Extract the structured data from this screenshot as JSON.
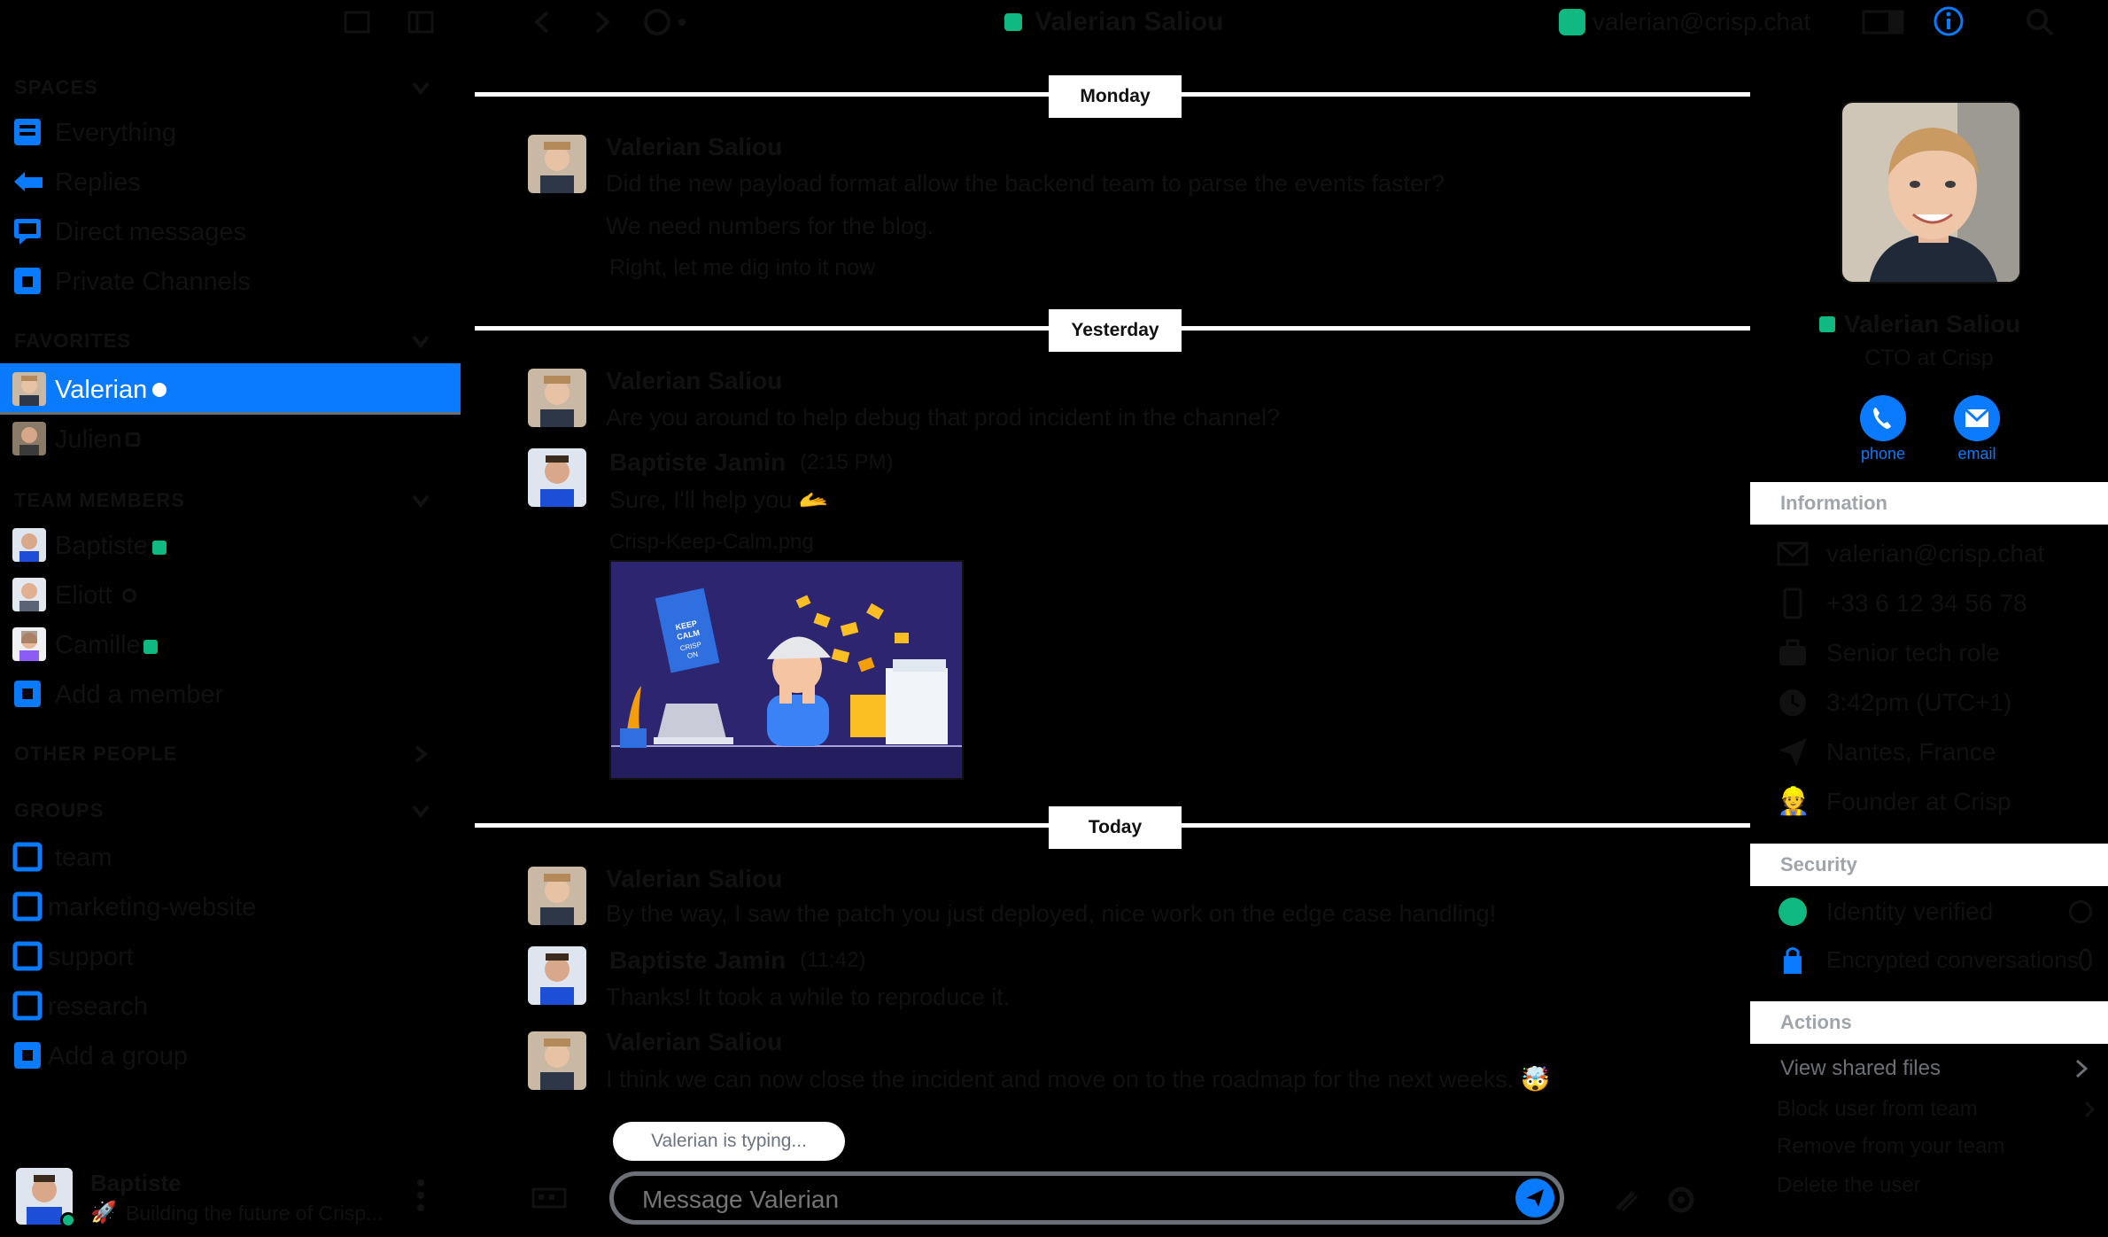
{
  "window": {
    "title": "Valerian Saliou",
    "account": "valerian@crisp.chat"
  },
  "sidebar": {
    "spaces_header": "SPACES",
    "spaces": [
      {
        "label": "Everything",
        "icon": "everything-icon"
      },
      {
        "label": "Replies",
        "icon": "replies-icon"
      },
      {
        "label": "Direct messages",
        "icon": "direct-messages-icon"
      },
      {
        "label": "Private Channels",
        "icon": "private-channels-icon"
      }
    ],
    "favorites_header": "FAVORITES",
    "favorites": [
      {
        "label": "Valerian",
        "selected": true
      },
      {
        "label": "Julien",
        "selected": false
      }
    ],
    "team_header": "TEAM MEMBERS",
    "team": [
      {
        "label": "Baptiste",
        "presence": "online"
      },
      {
        "label": "Eliott",
        "presence": "away"
      },
      {
        "label": "Camille",
        "presence": "online"
      },
      {
        "label": "Add a member",
        "presence": "none"
      }
    ],
    "other_header": "OTHER PEOPLE",
    "groups_header": "GROUPS",
    "groups": [
      {
        "label": "team"
      },
      {
        "label": "marketing-website"
      },
      {
        "label": "support"
      },
      {
        "label": "research"
      },
      {
        "label": "Add a group"
      }
    ],
    "user": {
      "name": "Baptiste",
      "status": "Building the future of Crisp..."
    }
  },
  "chat": {
    "days": [
      {
        "label": "Monday",
        "messages": [
          {
            "author": "Valerian Saliou",
            "lines": [
              "Did the new payload format allow the backend team to parse the events faster?",
              "We need numbers for the blog.",
              "Right, let me dig into it now"
            ]
          }
        ]
      },
      {
        "label": "Yesterday",
        "messages": [
          {
            "author": "Valerian Saliou",
            "lines": [
              "Are you around to help debug that prod incident in the channel?"
            ]
          },
          {
            "author": "Baptiste Jamin",
            "meta": "(2:15 PM)",
            "lines": [
              "Sure, I'll help you 🫴"
            ],
            "file": "Crisp-Keep-Calm.png"
          }
        ]
      },
      {
        "label": "Today",
        "messages": [
          {
            "author": "Valerian Saliou",
            "lines": [
              "By the way, I saw the patch you just deployed, nice work on the edge case handling!"
            ]
          },
          {
            "author": "Baptiste Jamin",
            "meta": "(11:42)",
            "lines": [
              "Thanks! It took a while to reproduce it."
            ]
          },
          {
            "author": "Valerian Saliou",
            "lines": [
              "I think we can now close the incident and move on to the roadmap for the next weeks. 🤯"
            ]
          }
        ]
      }
    ],
    "typing": "Valerian is typing...",
    "composer": {
      "placeholder": "Message Valerian"
    }
  },
  "profile": {
    "name": "Valerian Saliou",
    "role": "CTO at Crisp",
    "actions": [
      {
        "label": "phone",
        "icon": "phone-icon"
      },
      {
        "label": "email",
        "icon": "email-icon"
      }
    ],
    "info_header": "Information",
    "info": [
      {
        "text": "valerian@crisp.chat",
        "icon": "email-icon"
      },
      {
        "text": "+33 6 12 34 56 78",
        "icon": "mobile-icon"
      },
      {
        "text": "Senior tech role",
        "icon": "briefcase-icon"
      },
      {
        "text": "3:42pm (UTC+1)",
        "icon": "clock-icon"
      },
      {
        "text": "Nantes, France",
        "icon": "location-icon"
      },
      {
        "text": "Founder at Crisp",
        "icon": "user-icon"
      }
    ],
    "security_header": "Security",
    "security": [
      {
        "text": "Identity verified",
        "icon": "verified-icon"
      },
      {
        "text": "Encrypted conversations",
        "icon": "lock-icon"
      }
    ],
    "actions_header": "Actions",
    "action_links": [
      {
        "text": "View shared files"
      },
      {
        "text": "Block user from team"
      },
      {
        "text": "Remove from your team"
      },
      {
        "text": "Delete the user"
      }
    ]
  },
  "colors": {
    "accent": "#0a7bff",
    "online": "#10b981",
    "selected_bg": "#0a7bff",
    "panel_header": "#a0a4ab"
  }
}
